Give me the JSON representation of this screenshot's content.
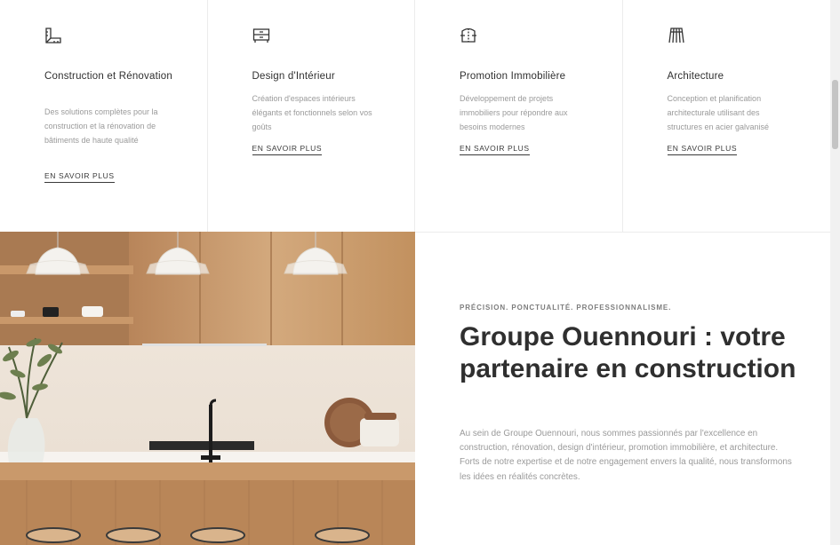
{
  "services": [
    {
      "title": "Construction et Rénovation",
      "icon": "square-ruler-icon",
      "description": "Des solutions complètes pour la construction et la rénovation de bâtiments de haute qualité",
      "link": "EN SAVOIR PLUS"
    },
    {
      "title": "Design d'Intérieur",
      "icon": "cabinet-icon",
      "description": "Création d'espaces intérieurs élégants et fonctionnels selon vos goûts",
      "link": "EN SAVOIR PLUS"
    },
    {
      "title": "Promotion Immobilière",
      "icon": "building-blueprint-icon",
      "description": "Développement de projets immobiliers pour répondre aux besoins modernes",
      "link": "EN SAVOIR PLUS"
    },
    {
      "title": "Architecture",
      "icon": "steel-structure-icon",
      "description": "Conception et planification architecturale utilisant des structures en acier galvanisé",
      "link": "EN SAVOIR PLUS"
    }
  ],
  "about": {
    "eyebrow": "PRÉCISION. PONCTUALITÉ. PROFESSIONNALISME.",
    "headline": "Groupe Ouennouri : votre partenaire en construction",
    "text": "Au sein de Groupe Ouennouri, nous sommes passionnés par l'excellence en construction, rénovation, design d'intérieur, promotion immobilière, et architecture. Forts de notre expertise et de notre engagement envers la qualité, nous transformons les idées en réalités concrètes."
  },
  "image": {
    "subject": "modern-kitchen-photo"
  },
  "colors": {
    "text": "#2f2f2f",
    "muted": "#9a9a9a",
    "wood": "#c89a6c",
    "divider": "#ececec"
  }
}
